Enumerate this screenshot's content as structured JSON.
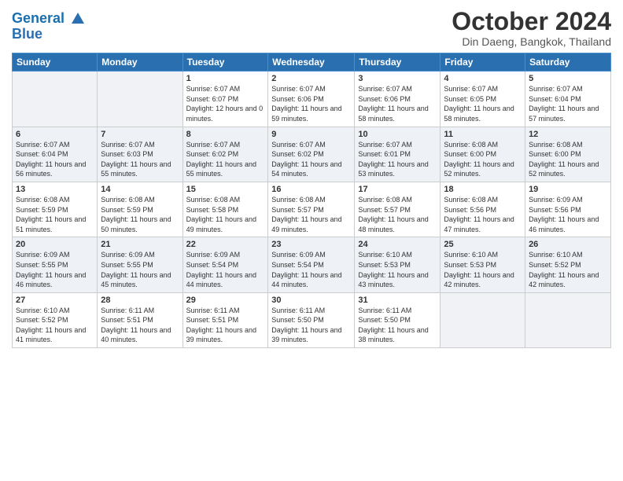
{
  "header": {
    "logo_line1": "General",
    "logo_line2": "Blue",
    "month": "October 2024",
    "location": "Din Daeng, Bangkok, Thailand"
  },
  "weekdays": [
    "Sunday",
    "Monday",
    "Tuesday",
    "Wednesday",
    "Thursday",
    "Friday",
    "Saturday"
  ],
  "weeks": [
    [
      {
        "day": "",
        "sunrise": "",
        "sunset": "",
        "daylight": ""
      },
      {
        "day": "",
        "sunrise": "",
        "sunset": "",
        "daylight": ""
      },
      {
        "day": "1",
        "sunrise": "Sunrise: 6:07 AM",
        "sunset": "Sunset: 6:07 PM",
        "daylight": "Daylight: 12 hours and 0 minutes."
      },
      {
        "day": "2",
        "sunrise": "Sunrise: 6:07 AM",
        "sunset": "Sunset: 6:06 PM",
        "daylight": "Daylight: 11 hours and 59 minutes."
      },
      {
        "day": "3",
        "sunrise": "Sunrise: 6:07 AM",
        "sunset": "Sunset: 6:06 PM",
        "daylight": "Daylight: 11 hours and 58 minutes."
      },
      {
        "day": "4",
        "sunrise": "Sunrise: 6:07 AM",
        "sunset": "Sunset: 6:05 PM",
        "daylight": "Daylight: 11 hours and 58 minutes."
      },
      {
        "day": "5",
        "sunrise": "Sunrise: 6:07 AM",
        "sunset": "Sunset: 6:04 PM",
        "daylight": "Daylight: 11 hours and 57 minutes."
      }
    ],
    [
      {
        "day": "6",
        "sunrise": "Sunrise: 6:07 AM",
        "sunset": "Sunset: 6:04 PM",
        "daylight": "Daylight: 11 hours and 56 minutes."
      },
      {
        "day": "7",
        "sunrise": "Sunrise: 6:07 AM",
        "sunset": "Sunset: 6:03 PM",
        "daylight": "Daylight: 11 hours and 55 minutes."
      },
      {
        "day": "8",
        "sunrise": "Sunrise: 6:07 AM",
        "sunset": "Sunset: 6:02 PM",
        "daylight": "Daylight: 11 hours and 55 minutes."
      },
      {
        "day": "9",
        "sunrise": "Sunrise: 6:07 AM",
        "sunset": "Sunset: 6:02 PM",
        "daylight": "Daylight: 11 hours and 54 minutes."
      },
      {
        "day": "10",
        "sunrise": "Sunrise: 6:07 AM",
        "sunset": "Sunset: 6:01 PM",
        "daylight": "Daylight: 11 hours and 53 minutes."
      },
      {
        "day": "11",
        "sunrise": "Sunrise: 6:08 AM",
        "sunset": "Sunset: 6:00 PM",
        "daylight": "Daylight: 11 hours and 52 minutes."
      },
      {
        "day": "12",
        "sunrise": "Sunrise: 6:08 AM",
        "sunset": "Sunset: 6:00 PM",
        "daylight": "Daylight: 11 hours and 52 minutes."
      }
    ],
    [
      {
        "day": "13",
        "sunrise": "Sunrise: 6:08 AM",
        "sunset": "Sunset: 5:59 PM",
        "daylight": "Daylight: 11 hours and 51 minutes."
      },
      {
        "day": "14",
        "sunrise": "Sunrise: 6:08 AM",
        "sunset": "Sunset: 5:59 PM",
        "daylight": "Daylight: 11 hours and 50 minutes."
      },
      {
        "day": "15",
        "sunrise": "Sunrise: 6:08 AM",
        "sunset": "Sunset: 5:58 PM",
        "daylight": "Daylight: 11 hours and 49 minutes."
      },
      {
        "day": "16",
        "sunrise": "Sunrise: 6:08 AM",
        "sunset": "Sunset: 5:57 PM",
        "daylight": "Daylight: 11 hours and 49 minutes."
      },
      {
        "day": "17",
        "sunrise": "Sunrise: 6:08 AM",
        "sunset": "Sunset: 5:57 PM",
        "daylight": "Daylight: 11 hours and 48 minutes."
      },
      {
        "day": "18",
        "sunrise": "Sunrise: 6:08 AM",
        "sunset": "Sunset: 5:56 PM",
        "daylight": "Daylight: 11 hours and 47 minutes."
      },
      {
        "day": "19",
        "sunrise": "Sunrise: 6:09 AM",
        "sunset": "Sunset: 5:56 PM",
        "daylight": "Daylight: 11 hours and 46 minutes."
      }
    ],
    [
      {
        "day": "20",
        "sunrise": "Sunrise: 6:09 AM",
        "sunset": "Sunset: 5:55 PM",
        "daylight": "Daylight: 11 hours and 46 minutes."
      },
      {
        "day": "21",
        "sunrise": "Sunrise: 6:09 AM",
        "sunset": "Sunset: 5:55 PM",
        "daylight": "Daylight: 11 hours and 45 minutes."
      },
      {
        "day": "22",
        "sunrise": "Sunrise: 6:09 AM",
        "sunset": "Sunset: 5:54 PM",
        "daylight": "Daylight: 11 hours and 44 minutes."
      },
      {
        "day": "23",
        "sunrise": "Sunrise: 6:09 AM",
        "sunset": "Sunset: 5:54 PM",
        "daylight": "Daylight: 11 hours and 44 minutes."
      },
      {
        "day": "24",
        "sunrise": "Sunrise: 6:10 AM",
        "sunset": "Sunset: 5:53 PM",
        "daylight": "Daylight: 11 hours and 43 minutes."
      },
      {
        "day": "25",
        "sunrise": "Sunrise: 6:10 AM",
        "sunset": "Sunset: 5:53 PM",
        "daylight": "Daylight: 11 hours and 42 minutes."
      },
      {
        "day": "26",
        "sunrise": "Sunrise: 6:10 AM",
        "sunset": "Sunset: 5:52 PM",
        "daylight": "Daylight: 11 hours and 42 minutes."
      }
    ],
    [
      {
        "day": "27",
        "sunrise": "Sunrise: 6:10 AM",
        "sunset": "Sunset: 5:52 PM",
        "daylight": "Daylight: 11 hours and 41 minutes."
      },
      {
        "day": "28",
        "sunrise": "Sunrise: 6:11 AM",
        "sunset": "Sunset: 5:51 PM",
        "daylight": "Daylight: 11 hours and 40 minutes."
      },
      {
        "day": "29",
        "sunrise": "Sunrise: 6:11 AM",
        "sunset": "Sunset: 5:51 PM",
        "daylight": "Daylight: 11 hours and 39 minutes."
      },
      {
        "day": "30",
        "sunrise": "Sunrise: 6:11 AM",
        "sunset": "Sunset: 5:50 PM",
        "daylight": "Daylight: 11 hours and 39 minutes."
      },
      {
        "day": "31",
        "sunrise": "Sunrise: 6:11 AM",
        "sunset": "Sunset: 5:50 PM",
        "daylight": "Daylight: 11 hours and 38 minutes."
      },
      {
        "day": "",
        "sunrise": "",
        "sunset": "",
        "daylight": ""
      },
      {
        "day": "",
        "sunrise": "",
        "sunset": "",
        "daylight": ""
      }
    ]
  ]
}
